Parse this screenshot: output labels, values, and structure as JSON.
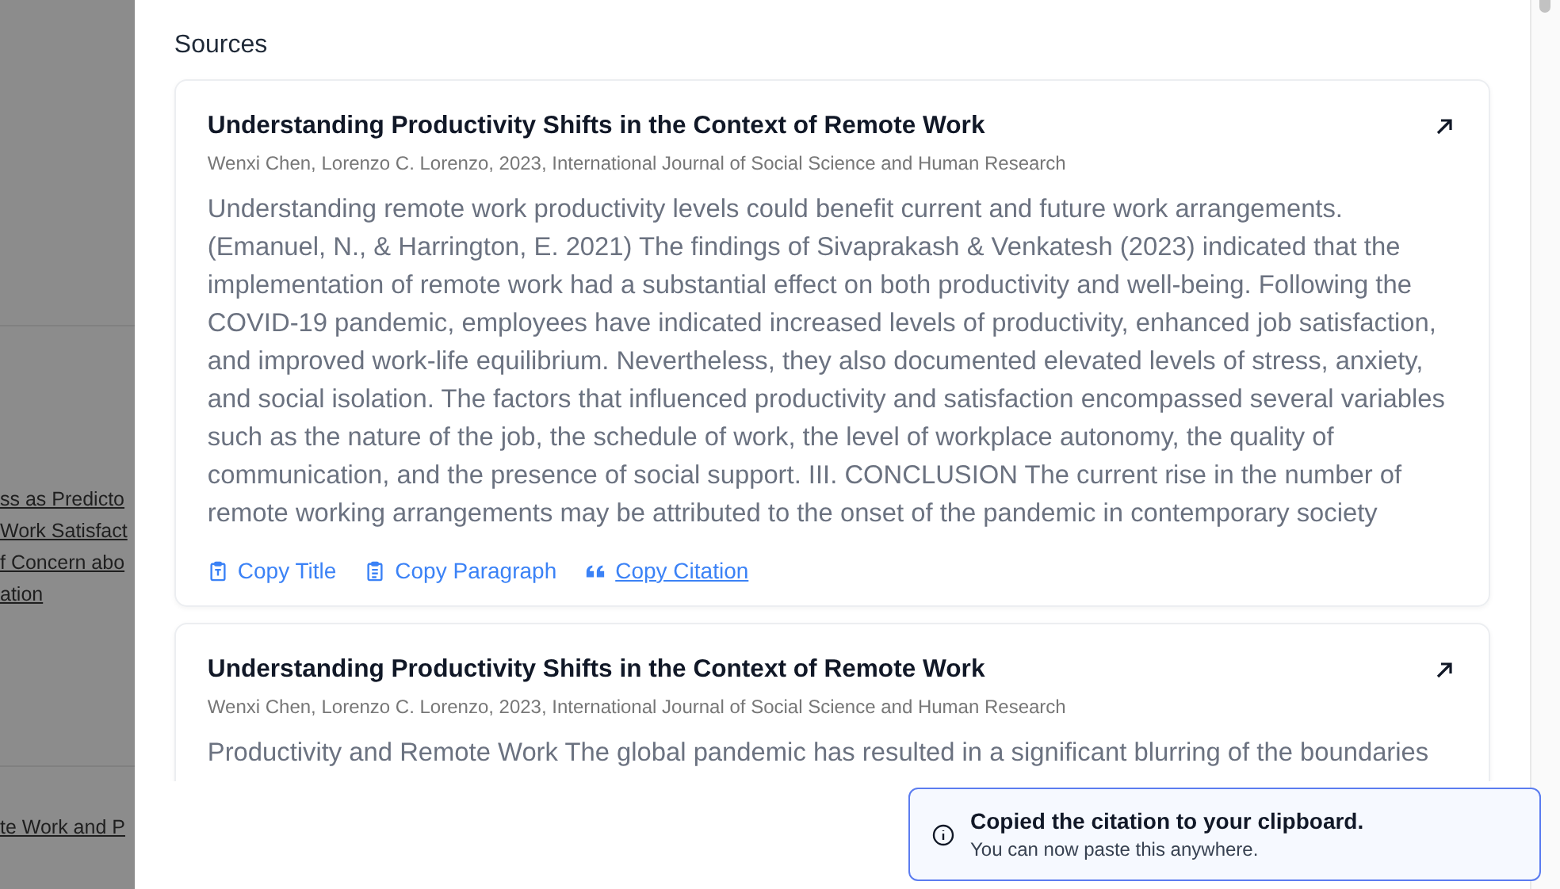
{
  "background": {
    "groups": [
      {
        "lines": [
          "ss as Predicto",
          "Work Satisfact",
          "f Concern abo",
          "ation"
        ]
      },
      {
        "lines": [
          "te Work and P"
        ]
      }
    ]
  },
  "modal": {
    "heading": "Sources",
    "sources": [
      {
        "title": "Understanding Productivity Shifts in the Context of Remote Work",
        "meta": "Wenxi Chen, Lorenzo C. Lorenzo, 2023, International Journal of Social Science and Human Research",
        "paragraph": "Understanding remote work productivity levels could benefit current and future work arrangements. (Emanuel, N., & Harrington, E. 2021) The findings of Sivaprakash & Venkatesh (2023) indicated that the implementation of remote work had a substantial effect on both productivity and well-being. Following the COVID-19 pandemic, employees have indicated increased levels of productivity, enhanced job satisfaction, and improved work-life equilibrium. Nevertheless, they also documented elevated levels of stress, anxiety, and social isolation. The factors that influenced productivity and satisfaction encompassed several variables such as the nature of the job, the schedule of work, the level of workplace autonomy, the quality of communication, and the presence of social support. III. CONCLUSION The current rise in the number of remote working arrangements may be attributed to the onset of the pandemic in contemporary society",
        "actions": [
          {
            "kind": "title",
            "label": "Copy Title",
            "active": false
          },
          {
            "kind": "paragraph",
            "label": "Copy Paragraph",
            "active": false
          },
          {
            "kind": "citation",
            "label": "Copy Citation",
            "active": true
          }
        ]
      },
      {
        "title": "Understanding Productivity Shifts in the Context of Remote Work",
        "meta": "Wenxi Chen, Lorenzo C. Lorenzo, 2023, International Journal of Social Science and Human Research",
        "paragraph": "Productivity and Remote Work The global pandemic has resulted in a significant blurring of the boundaries"
      }
    ]
  },
  "toast": {
    "title": "Copied the citation to your clipboard.",
    "message": "You can now paste this anywhere."
  }
}
